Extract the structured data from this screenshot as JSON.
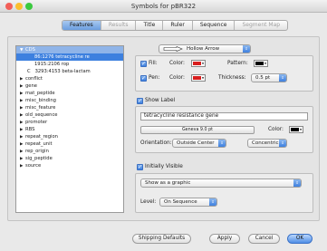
{
  "window": {
    "title": "Symbols for pBR322",
    "colors": {
      "close": "#f25f58",
      "minimize": "#fbbe2e",
      "zoom": "#3ac93f"
    }
  },
  "tabs": [
    {
      "label": "Features",
      "state": "active"
    },
    {
      "label": "Results",
      "state": "disabled"
    },
    {
      "label": "Title",
      "state": "normal"
    },
    {
      "label": "Ruler",
      "state": "normal"
    },
    {
      "label": "Sequence",
      "state": "normal"
    },
    {
      "label": "Segment Map",
      "state": "disabled"
    }
  ],
  "tree": {
    "root": {
      "label": "CDS",
      "expanded": true
    },
    "children": [
      {
        "label": "86:1276 tetracycline re",
        "selected": true
      },
      {
        "label": "1915:2106 rop"
      },
      {
        "label": "3293:4153 beta-lactam",
        "prefix": "C"
      }
    ],
    "collapsed": [
      "conflict",
      "gene",
      "mat_peptide",
      "misc_binding",
      "misc_feature",
      "old_sequence",
      "promoter",
      "RBS",
      "repeat_region",
      "repeat_unit",
      "rep_origin",
      "sig_peptide",
      "source"
    ]
  },
  "shape": {
    "value": "Hollow Arrow",
    "fill_label": "Fill:",
    "fill_color_label": "Color:",
    "fill_color": "#d81e1e",
    "pattern_label": "Pattern:",
    "pattern_color": "#000000",
    "pen_label": "Pen:",
    "pen_color_label": "Color:",
    "pen_color": "#d81e1e",
    "thickness_label": "Thickness:",
    "thickness_value": "0.5 pt"
  },
  "label": {
    "show_label": "Show Label",
    "text": "tetracycline resistance gene",
    "font": "Geneva 9.0 pt",
    "color_label": "Color:",
    "color": "#000000",
    "orientation_label": "Orientation:",
    "orientation_value": "Outside Center",
    "concentric_value": "Concentric"
  },
  "visibility": {
    "initially_visible": "Initially Visible",
    "show_as": "Show as a graphic",
    "level_label": "Level:",
    "level_value": "On Sequence"
  },
  "buttons": {
    "defaults": "Shipping Defaults",
    "apply": "Apply",
    "cancel": "Cancel",
    "ok": "OK"
  }
}
